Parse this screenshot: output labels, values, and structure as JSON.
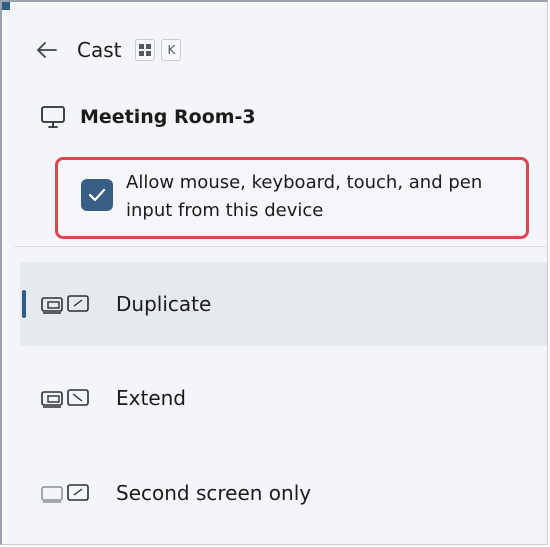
{
  "header": {
    "title": "Cast",
    "shortcut_keys": [
      "⊞",
      "K"
    ]
  },
  "device": {
    "name": "Meeting Room-3"
  },
  "input_option": {
    "label": "Allow mouse, keyboard, touch, and pen input from this device",
    "checked": true
  },
  "modes": [
    {
      "label": "Duplicate",
      "selected": true,
      "icon": "duplicate-icon"
    },
    {
      "label": "Extend",
      "selected": false,
      "icon": "extend-icon"
    },
    {
      "label": "Second screen only",
      "selected": false,
      "icon": "second-screen-only-icon"
    }
  ],
  "colors": {
    "accent": "#2f5d8a",
    "checkbox": "#3a5f86",
    "highlight_border": "#d84a4f"
  }
}
